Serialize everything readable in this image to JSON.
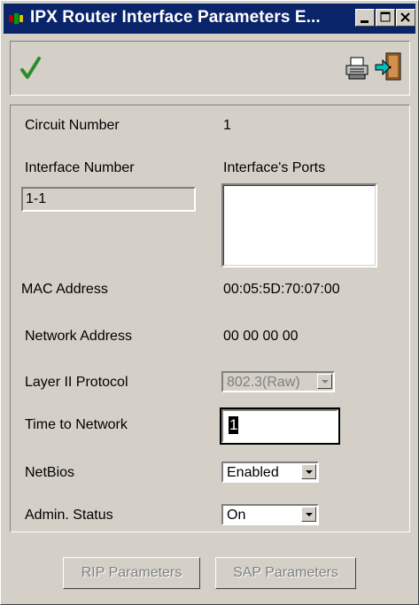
{
  "window": {
    "title": "IPX Router Interface Parameters E...",
    "minimize_label": "_",
    "maximize_label": "□",
    "close_label": "×"
  },
  "toolbar": {
    "apply_icon": "checkmark-icon",
    "print_icon": "printer-icon",
    "exit_icon": "exit-door-icon"
  },
  "fields": {
    "circuit_number_label": "Circuit Number",
    "circuit_number_value": "1",
    "interface_number_label": "Interface Number",
    "interface_number_value": "1-1",
    "interface_ports_label": "Interface's Ports",
    "mac_address_label": "MAC Address",
    "mac_address_value": "00:05:5D:70:07:00",
    "network_address_label": "Network Address",
    "network_address_value": "00 00 00 00",
    "layer2_protocol_label": "Layer II Protocol",
    "layer2_protocol_value": "802.3(Raw)",
    "time_to_network_label": "Time to Network",
    "time_to_network_value": "1",
    "netbios_label": "NetBios",
    "netbios_value": "Enabled",
    "admin_status_label": "Admin. Status",
    "admin_status_value": "On"
  },
  "buttons": {
    "rip_label": "RIP Parameters",
    "sap_label": "SAP Parameters"
  },
  "colors": {
    "titlebar": "#0a246a",
    "face": "#d4d0c8",
    "check_green": "#2e8b2e"
  }
}
